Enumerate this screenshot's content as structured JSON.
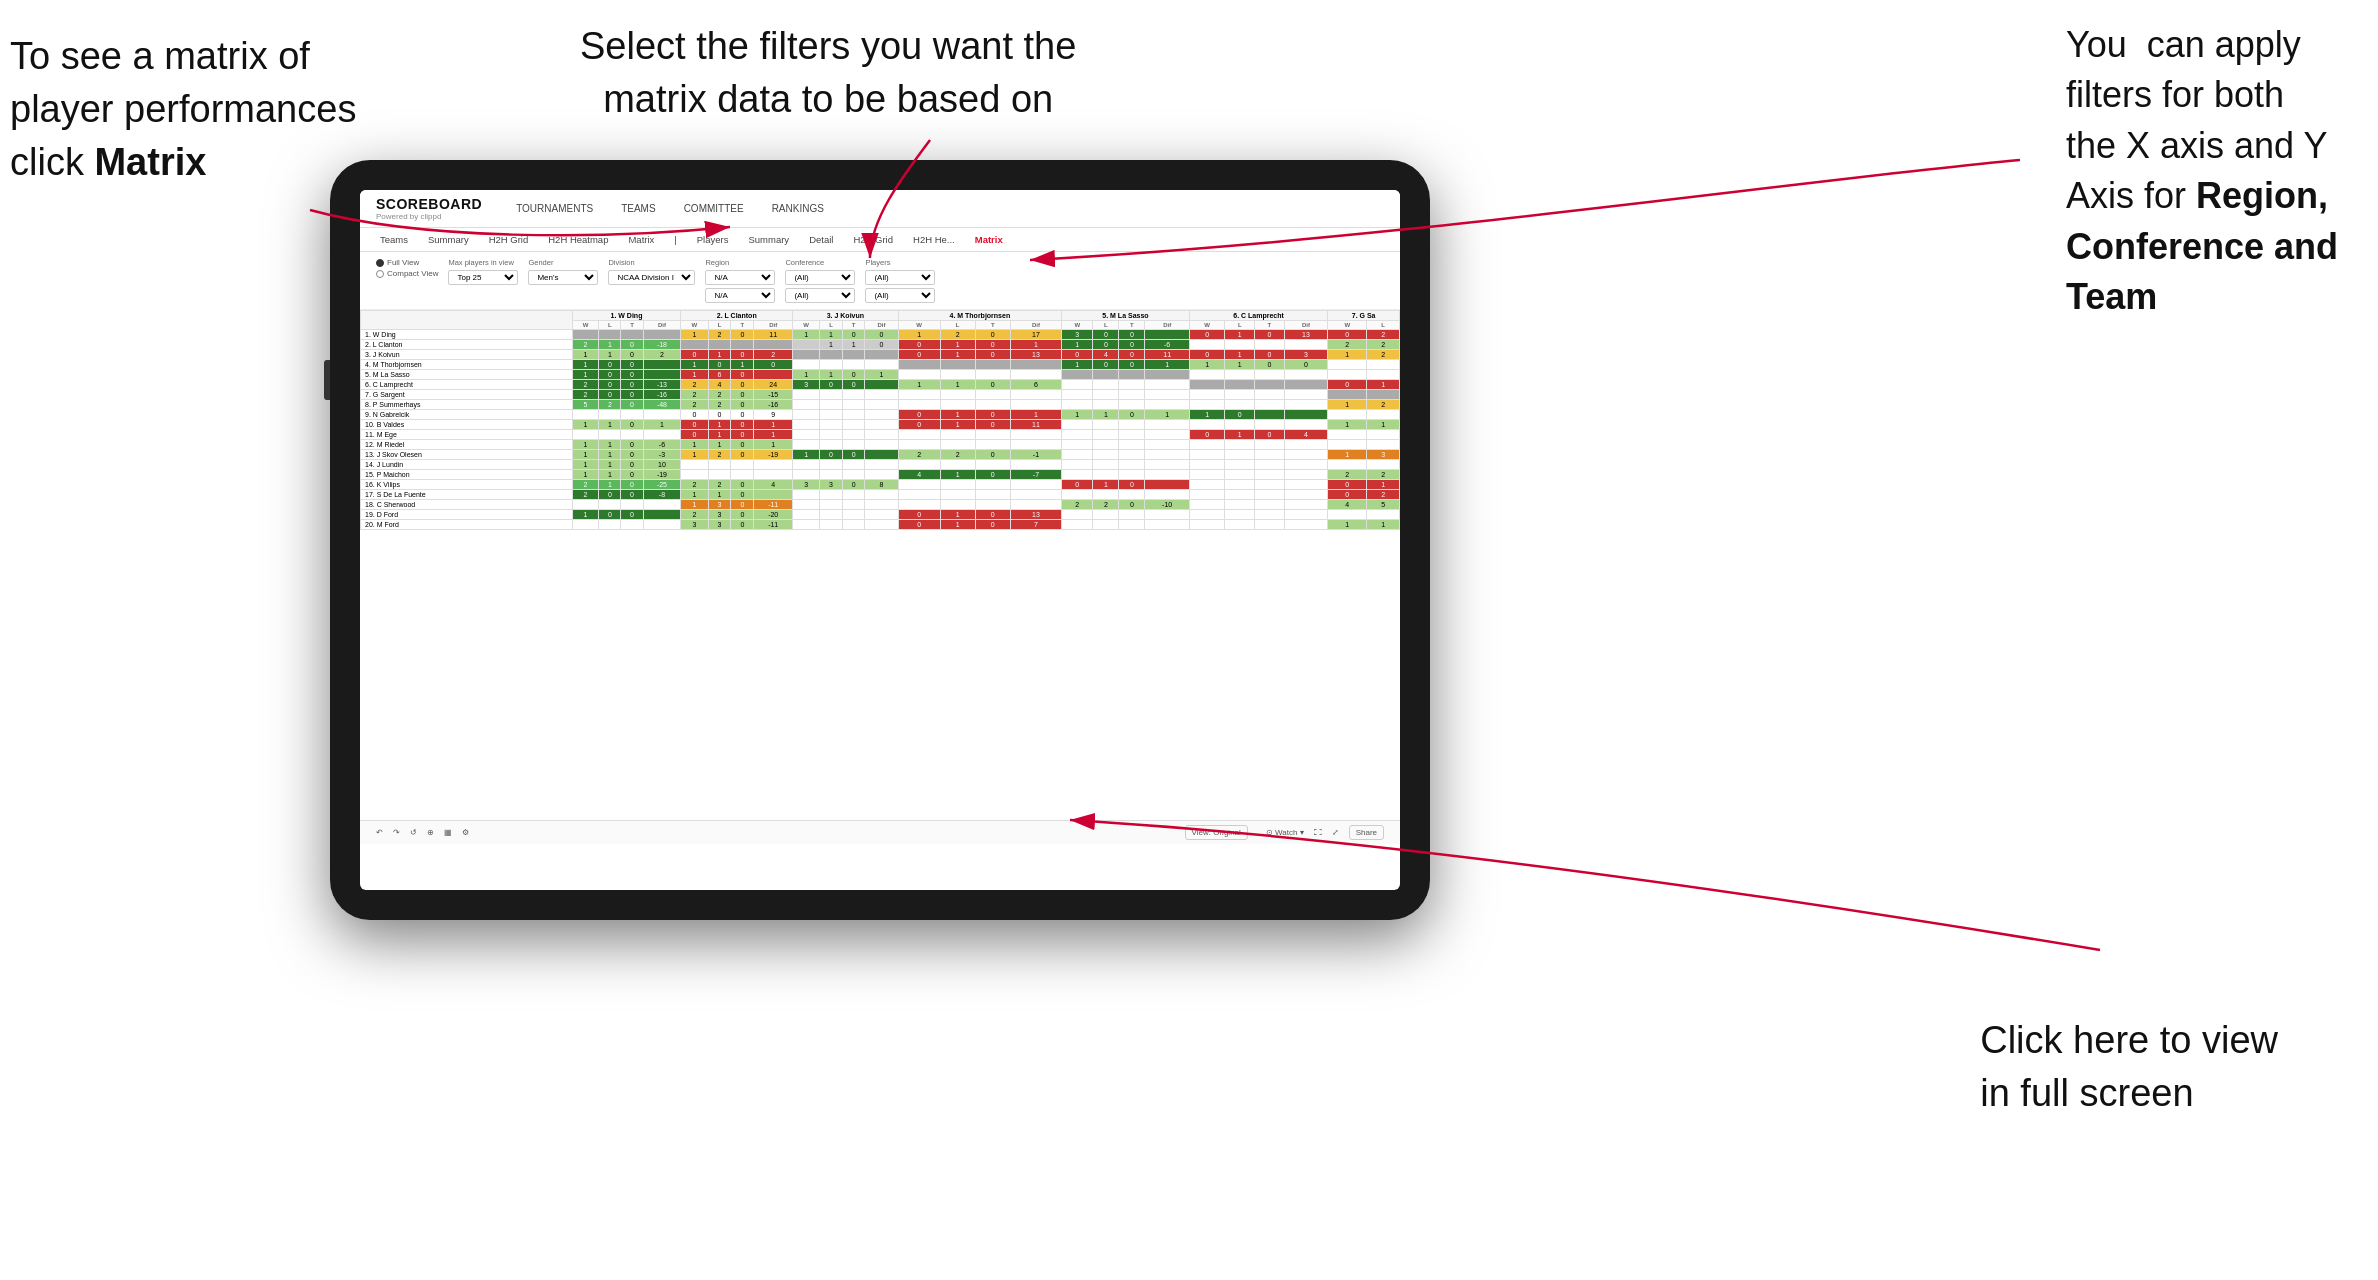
{
  "annotations": {
    "top_left": {
      "line1": "To see a matrix of",
      "line2": "player performances",
      "line3_normal": "click ",
      "line3_bold": "Matrix"
    },
    "top_center": {
      "line1": "Select the filters you want the",
      "line2": "matrix data to be based on"
    },
    "top_right": {
      "line1": "You  can apply",
      "line2": "filters for both",
      "line3": "the X axis and Y",
      "line4_normal": "Axis for ",
      "line4_bold": "Region,",
      "line5_bold": "Conference and",
      "line6_bold": "Team"
    },
    "bottom_right": {
      "line1": "Click here to view",
      "line2": "in full screen"
    }
  },
  "app": {
    "logo_title": "SCOREBOARD",
    "logo_subtitle": "Powered by clippd",
    "nav": [
      "TOURNAMENTS",
      "TEAMS",
      "COMMITTEE",
      "RANKINGS"
    ],
    "sub_nav": [
      "Teams",
      "Summary",
      "H2H Grid",
      "H2H Heatmap",
      "Matrix",
      "Players",
      "Summary",
      "Detail",
      "H2H Grid",
      "H2H He...",
      "Matrix"
    ],
    "active_tab": "Matrix"
  },
  "filters": {
    "view_options": [
      "Full View",
      "Compact View"
    ],
    "selected_view": "Full View",
    "max_players_label": "Max players in view",
    "max_players_value": "Top 25",
    "gender_label": "Gender",
    "gender_value": "Men's",
    "division_label": "Division",
    "division_value": "NCAA Division I",
    "region_label": "Region",
    "region_value": "N/A",
    "region_value2": "N/A",
    "conference_label": "Conference",
    "conference_value": "(All)",
    "conference_value2": "(All)",
    "players_label": "Players",
    "players_value": "(All)",
    "players_value2": "(All)"
  },
  "matrix": {
    "column_headers": [
      "1. W Ding",
      "2. L Clanton",
      "3. J Koivun",
      "4. M Thorbjornsen",
      "5. M La Sasso",
      "6. C Lamprecht",
      "7. G Sa"
    ],
    "sub_headers": [
      "W",
      "L",
      "T",
      "Dif"
    ],
    "rows": [
      {
        "name": "1. W Ding",
        "cells": "g g g g g g"
      },
      {
        "name": "2. L Clanton",
        "cells": "g g g g g g"
      },
      {
        "name": "3. J Koivun",
        "cells": "g y g g g g"
      },
      {
        "name": "4. M Thorbjornsen",
        "cells": "g g g g g g"
      },
      {
        "name": "5. M La Sasso",
        "cells": "g g g g g g"
      },
      {
        "name": "6. C Lamprecht",
        "cells": "g g g g g g"
      },
      {
        "name": "7. G Sargent",
        "cells": "g g g g g g"
      },
      {
        "name": "8. P Summerhays",
        "cells": "g g g g g g"
      },
      {
        "name": "9. N Gabrelcik",
        "cells": "g g g g g g"
      },
      {
        "name": "10. B Valdes",
        "cells": "g g g g g g"
      },
      {
        "name": "11. M Ege",
        "cells": "g g g g g g"
      },
      {
        "name": "12. M Riedel",
        "cells": "g g g g g g"
      },
      {
        "name": "13. J Skov Olesen",
        "cells": "g g g g g g"
      },
      {
        "name": "14. J Lundin",
        "cells": "g g g g g g"
      },
      {
        "name": "15. P Maichon",
        "cells": "g g g g g g"
      },
      {
        "name": "16. K Vilips",
        "cells": "g g g g g g"
      },
      {
        "name": "17. S De La Fuente",
        "cells": "g g g g g g"
      },
      {
        "name": "18. C Sherwood",
        "cells": "g g g g g g"
      },
      {
        "name": "19. D Ford",
        "cells": "g g g g g g"
      },
      {
        "name": "20. M Ford",
        "cells": "g g g g g g"
      }
    ]
  },
  "footer": {
    "view_original": "View: Original",
    "watch": "Watch",
    "share": "Share"
  }
}
